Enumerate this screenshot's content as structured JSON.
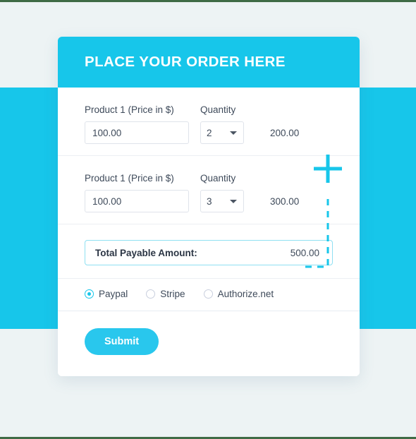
{
  "page": {
    "background_color": "#edf3f4",
    "accent_color": "#17c6ea",
    "rule_color": "#3f6b45"
  },
  "header": {
    "title": "PLACE YOUR ORDER HERE"
  },
  "products": [
    {
      "price_label": "Product 1 (Price in $)",
      "quantity_label": "Quantity",
      "price_value": "100.00",
      "price_placeholder": "100.00",
      "quantity_value": "2",
      "line_total": "200.00"
    },
    {
      "price_label": "Product 1 (Price in $)",
      "quantity_label": "Quantity",
      "price_value": "100.00",
      "price_placeholder": "100.00",
      "quantity_value": "3",
      "line_total": "300.00"
    }
  ],
  "total": {
    "label": "Total Payable Amount:",
    "value": "500.00"
  },
  "payment_methods": [
    {
      "label": "Paypal",
      "selected": true
    },
    {
      "label": "Stripe",
      "selected": false
    },
    {
      "label": "Authorize.net",
      "selected": false
    }
  ],
  "submit": {
    "label": "Submit"
  },
  "annotation": {
    "icon": "plus-icon",
    "connector": "dashed-callout-line",
    "color": "#17c6ea"
  }
}
